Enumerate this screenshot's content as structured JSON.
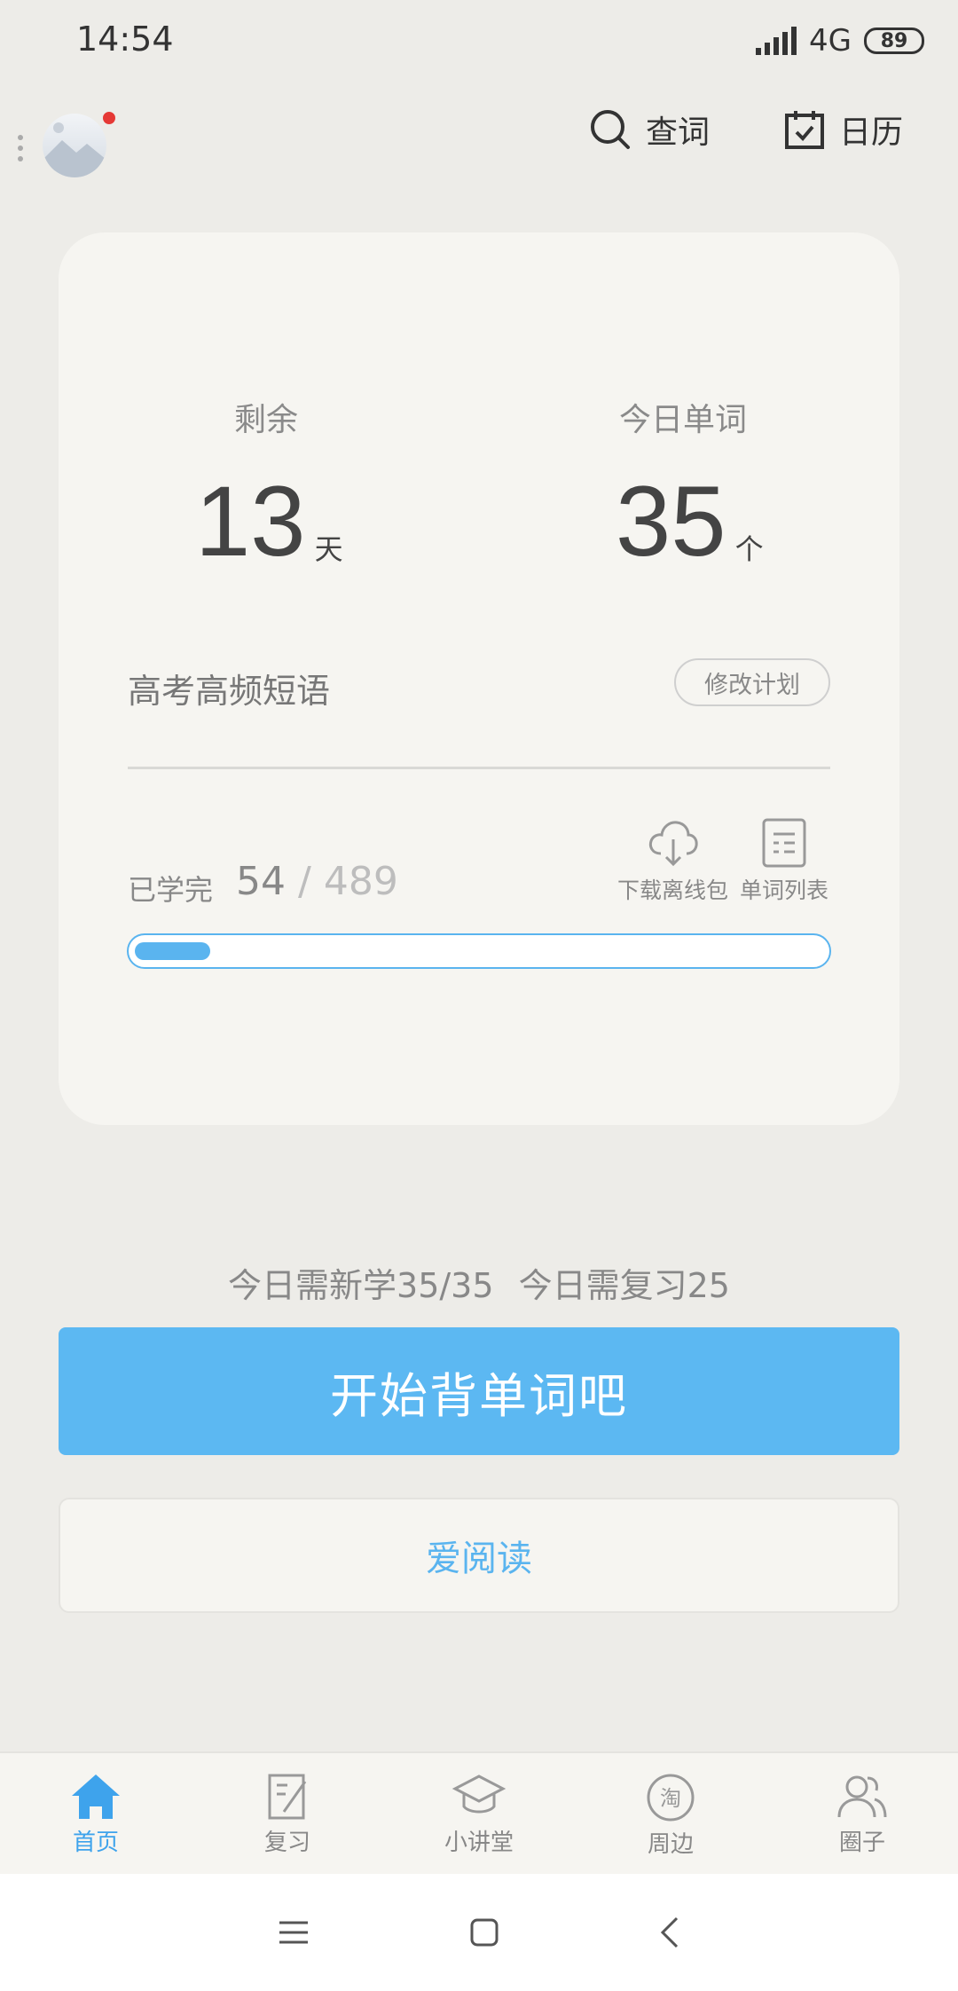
{
  "status_bar": {
    "time": "14:54",
    "network": "4G",
    "battery": "89"
  },
  "header": {
    "search_label": "查词",
    "calendar_label": "日历"
  },
  "plan_card": {
    "remaining_label": "剩余",
    "remaining_value": "13",
    "remaining_unit": "天",
    "today_words_label": "今日单词",
    "today_words_value": "35",
    "today_words_unit": "个",
    "plan_name": "高考高频短语",
    "edit_plan_label": "修改计划",
    "learned_label": "已学完",
    "learned_count": "54",
    "separator": "/",
    "total_count": "489",
    "download_label": "下载离线包",
    "word_list_label": "单词列表",
    "progress_fraction": 0.11
  },
  "summary": {
    "new_today": "今日需新学35/35",
    "review_today": "今日需复习25"
  },
  "start_button": "开始背单词吧",
  "read_button": "爱阅读",
  "bottom_nav": [
    {
      "label": "首页",
      "icon": "home-icon",
      "active": true
    },
    {
      "label": "复习",
      "icon": "review-icon",
      "active": false
    },
    {
      "label": "小讲堂",
      "icon": "graduation-cap-icon",
      "active": false
    },
    {
      "label": "周边",
      "icon": "taobao-icon",
      "active": false
    },
    {
      "label": "圈子",
      "icon": "people-icon",
      "active": false
    }
  ],
  "colors": {
    "accent": "#5cb8f2",
    "background": "#edece8",
    "card": "#f6f5f1",
    "notification": "#e53935"
  }
}
